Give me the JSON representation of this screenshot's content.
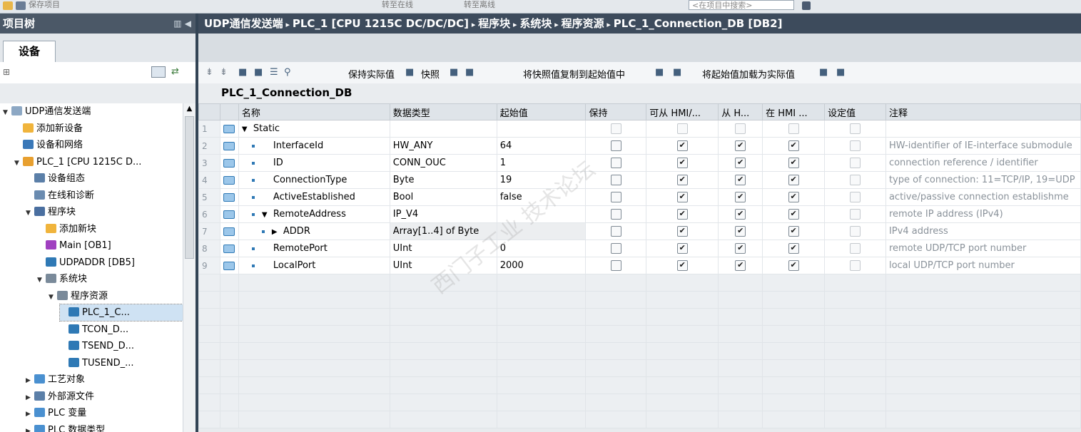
{
  "toolbar": {
    "items": [
      "保存项目",
      "转至在线",
      "转至离线"
    ],
    "search_placeholder": "<在项目中搜索>"
  },
  "left_panel": {
    "title": "项目树",
    "tab": "设备",
    "tree": [
      {
        "label": "UDP通信发送端",
        "level": 0,
        "arrow": "▼"
      },
      {
        "label": "添加新设备",
        "level": 1,
        "arrow": ""
      },
      {
        "label": "设备和网络",
        "level": 1,
        "arrow": ""
      },
      {
        "label": "PLC_1 [CPU 1215C D...",
        "level": 1,
        "arrow": "▼"
      },
      {
        "label": "设备组态",
        "level": 2,
        "arrow": ""
      },
      {
        "label": "在线和诊断",
        "level": 2,
        "arrow": ""
      },
      {
        "label": "程序块",
        "level": 2,
        "arrow": "▼"
      },
      {
        "label": "添加新块",
        "level": 3,
        "arrow": ""
      },
      {
        "label": "Main [OB1]",
        "level": 3,
        "arrow": ""
      },
      {
        "label": "UDPADDR [DB5]",
        "level": 3,
        "arrow": ""
      },
      {
        "label": "系统块",
        "level": 3,
        "arrow": "▼"
      },
      {
        "label": "程序资源",
        "level": 4,
        "arrow": "▼"
      },
      {
        "label": "PLC_1_C...",
        "level": 5,
        "arrow": "",
        "selected": true
      },
      {
        "label": "TCON_D...",
        "level": 5,
        "arrow": ""
      },
      {
        "label": "TSEND_D...",
        "level": 5,
        "arrow": ""
      },
      {
        "label": "TUSEND_...",
        "level": 5,
        "arrow": ""
      },
      {
        "label": "工艺对象",
        "level": 2,
        "arrow": "▶"
      },
      {
        "label": "外部源文件",
        "level": 2,
        "arrow": "▶"
      },
      {
        "label": "PLC 变量",
        "level": 2,
        "arrow": "▶"
      },
      {
        "label": "PLC 数据类型",
        "level": 2,
        "arrow": "▶"
      }
    ]
  },
  "breadcrumb": [
    "UDP通信发送端",
    "PLC_1 [CPU 1215C DC/DC/DC]",
    "程序块",
    "系统块",
    "程序资源",
    "PLC_1_Connection_DB [DB2]"
  ],
  "db_toolbar": {
    "keep_actual": "保持实际值",
    "snapshot": "快照",
    "copy_snapshot": "将快照值复制到起始值中",
    "load_start": "将起始值加载为实际值"
  },
  "db_title": "PLC_1_Connection_DB",
  "grid": {
    "headers": [
      "名称",
      "数据类型",
      "起始值",
      "保持",
      "可从 HMI/...",
      "从 H...",
      "在 HMI ...",
      "设定值",
      "注释"
    ],
    "rows": [
      {
        "num": "1",
        "name": "Static",
        "type": "",
        "start": "",
        "retain": false,
        "hmi1": false,
        "hmi2": false,
        "hmi3": false,
        "setpoint": false,
        "comment": "",
        "expand": "▼",
        "indent": 0,
        "bullet": false,
        "disabled": true
      },
      {
        "num": "2",
        "name": "InterfaceId",
        "type": "HW_ANY",
        "start": "64",
        "retain": false,
        "hmi1": true,
        "hmi2": true,
        "hmi3": true,
        "setpoint": false,
        "comment": "HW-identifier of IE-interface submodule",
        "expand": "",
        "indent": 1,
        "bullet": true
      },
      {
        "num": "3",
        "name": "ID",
        "type": "CONN_OUC",
        "start": "1",
        "retain": false,
        "hmi1": true,
        "hmi2": true,
        "hmi3": true,
        "setpoint": false,
        "comment": "connection reference / identifier",
        "expand": "",
        "indent": 1,
        "bullet": true
      },
      {
        "num": "4",
        "name": "ConnectionType",
        "type": "Byte",
        "start": "19",
        "retain": false,
        "hmi1": true,
        "hmi2": true,
        "hmi3": true,
        "setpoint": false,
        "comment": "type of connection: 11=TCP/IP, 19=UDP",
        "expand": "",
        "indent": 1,
        "bullet": true
      },
      {
        "num": "5",
        "name": "ActiveEstablished",
        "type": "Bool",
        "start": "false",
        "retain": false,
        "hmi1": true,
        "hmi2": true,
        "hmi3": true,
        "setpoint": false,
        "comment": "active/passive connection establishme",
        "expand": "",
        "indent": 1,
        "bullet": true
      },
      {
        "num": "6",
        "name": "RemoteAddress",
        "type": "IP_V4",
        "start": "",
        "retain": false,
        "hmi1": true,
        "hmi2": true,
        "hmi3": true,
        "setpoint": false,
        "comment": "remote IP address (IPv4)",
        "expand": "▼",
        "indent": 1,
        "bullet": true
      },
      {
        "num": "7",
        "name": "ADDR",
        "type": "Array[1..4] of Byte",
        "start": "",
        "retain": false,
        "hmi1": true,
        "hmi2": true,
        "hmi3": true,
        "setpoint": false,
        "comment": "IPv4 address",
        "expand": "▶",
        "indent": 2,
        "bullet": true,
        "grey": true
      },
      {
        "num": "8",
        "name": "RemotePort",
        "type": "UInt",
        "start": "0",
        "retain": false,
        "hmi1": true,
        "hmi2": true,
        "hmi3": true,
        "setpoint": false,
        "comment": "remote UDP/TCP port number",
        "expand": "",
        "indent": 1,
        "bullet": true
      },
      {
        "num": "9",
        "name": "LocalPort",
        "type": "UInt",
        "start": "2000",
        "retain": false,
        "hmi1": true,
        "hmi2": true,
        "hmi3": true,
        "setpoint": false,
        "comment": "local UDP/TCP port number",
        "expand": "",
        "indent": 1,
        "bullet": true
      }
    ]
  },
  "colors": {
    "header_dark": "#3d4b5c",
    "accent": "#2f79b5",
    "selected": "#cfe2f3"
  }
}
